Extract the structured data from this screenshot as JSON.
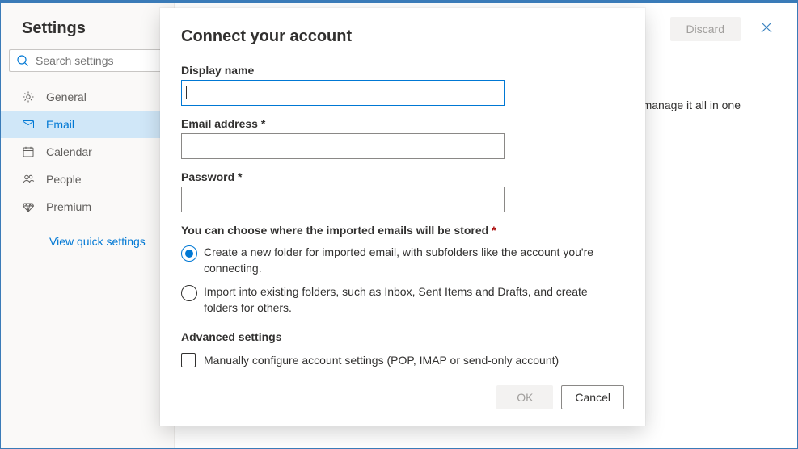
{
  "settings": {
    "title": "Settings",
    "search_placeholder": "Search settings",
    "nav": [
      {
        "key": "general",
        "label": "General"
      },
      {
        "key": "email",
        "label": "Email"
      },
      {
        "key": "calendar",
        "label": "Calendar"
      },
      {
        "key": "people",
        "label": "People"
      },
      {
        "key": "premium",
        "label": "Premium"
      }
    ],
    "quick_link": "View quick settings"
  },
  "topbar": {
    "discard_label": "Discard"
  },
  "background_text": "manage it all in one",
  "dialog": {
    "title": "Connect your account",
    "fields": {
      "display_name_label": "Display name",
      "display_name_value": "",
      "email_label": "Email address *",
      "email_value": "",
      "password_label": "Password *",
      "password_value": ""
    },
    "storage": {
      "group_label": "You can choose where the imported emails will be stored ",
      "required_star": "*",
      "option_new_folder": "Create a new folder for imported email, with subfolders like the account you're connecting.",
      "option_existing": "Import into existing folders, such as Inbox, Sent Items and Drafts, and create folders for others.",
      "selected": "new_folder"
    },
    "advanced": {
      "heading": "Advanced settings",
      "manual_label": "Manually configure account settings (POP, IMAP or send-only account)",
      "manual_checked": false
    },
    "buttons": {
      "ok": "OK",
      "cancel": "Cancel"
    }
  }
}
